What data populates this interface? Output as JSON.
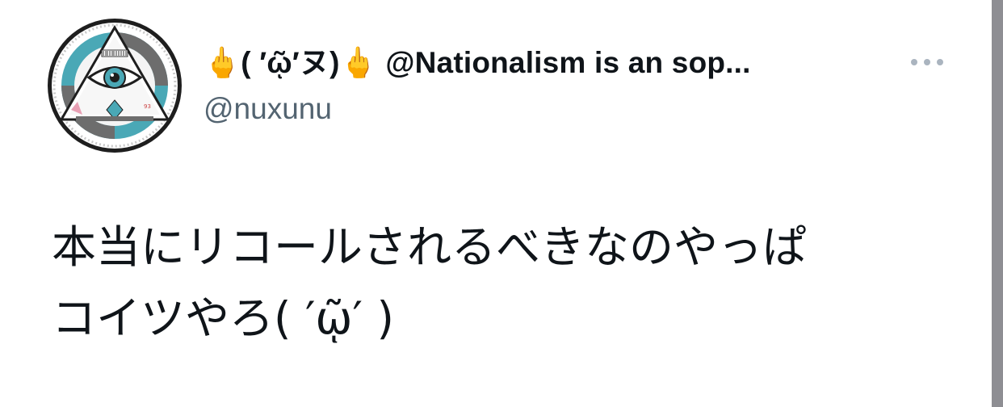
{
  "tweet": {
    "display_name": "🖕( ′ῷ′ヌ)🖕 @Nationalism is an sop...",
    "handle": "@nuxunu",
    "text": "本当にリコールされるべきなのやっぱ\nコイツやろ( ′ῷ′ )"
  },
  "icons": {
    "avatar": "illuminati-eye-avatar-icon",
    "more": "more-options-icon"
  },
  "colors": {
    "text": "#0f1419",
    "secondary": "#536471",
    "more_dots": "#aab4bf",
    "avatar_teal": "#4aa8b6",
    "avatar_gray": "#6d6d6d"
  }
}
